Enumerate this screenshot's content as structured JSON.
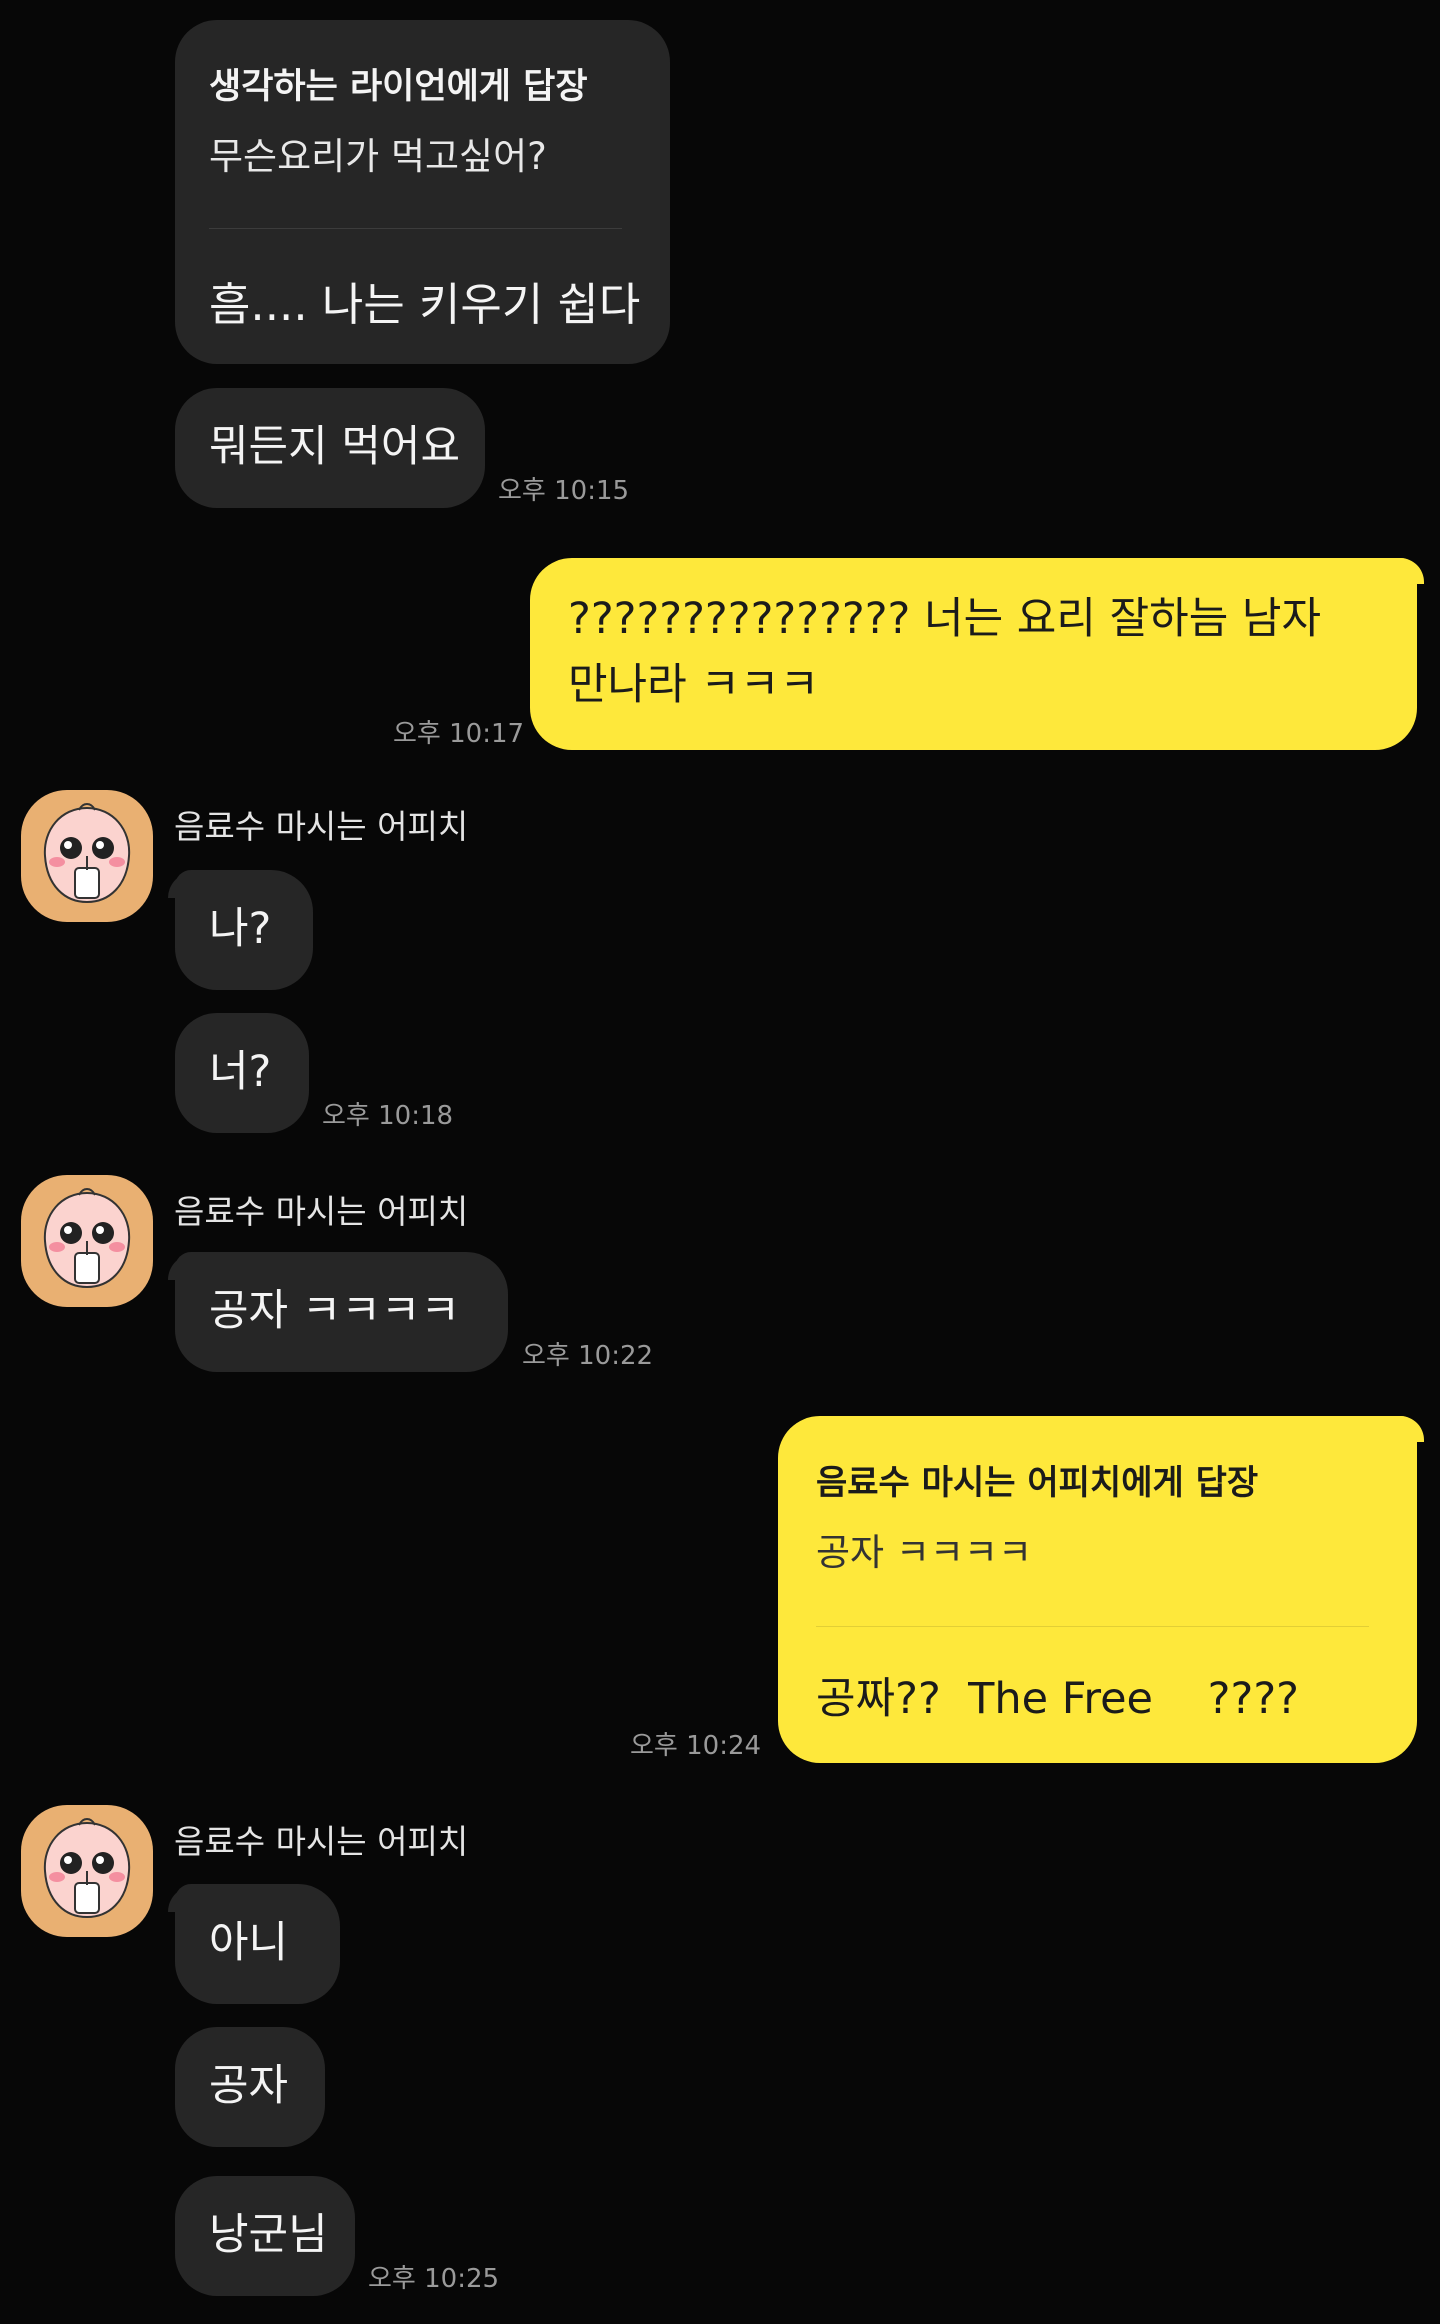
{
  "messages": {
    "m1": {
      "reply_to": "생각하는 라이언에게 답장",
      "quoted": "무슨요리가 먹고싶어?",
      "text": "흠.... 나는 키우기 쉽다"
    },
    "m2": {
      "text": "뭐든지 먹어요",
      "time": "오후 10:15"
    },
    "m3": {
      "line1": "???????????????  너는 요리 잘하늠 남자",
      "line2": "만나라 ㅋㅋㅋ",
      "time": "오후 10:17"
    },
    "group1": {
      "sender": "음료수 마시는 어피치",
      "m4": {
        "text": "나?"
      },
      "m5": {
        "text": "너?",
        "time": "오후 10:18"
      }
    },
    "group2": {
      "sender": "음료수 마시는 어피치",
      "m6": {
        "text": "공자 ㅋㅋㅋㅋ",
        "time": "오후 10:22"
      }
    },
    "m7": {
      "reply_to": "음료수 마시는 어피치에게 답장",
      "quoted": "공자 ㅋㅋㅋㅋ",
      "text": "공짜??  The Free    ????",
      "time": "오후 10:24"
    },
    "group3": {
      "sender": "음료수 마시는 어피치",
      "m8": {
        "text": "아니"
      },
      "m9": {
        "text": "공자"
      },
      "m10": {
        "text": "낭군님",
        "time": "오후 10:25"
      }
    }
  },
  "colors": {
    "background": "#070707",
    "incoming_bubble": "#262626",
    "outgoing_bubble": "#fee83b",
    "avatar_bg": "#e9b072"
  },
  "icons": {
    "avatar": "apeach-avatar-icon"
  }
}
